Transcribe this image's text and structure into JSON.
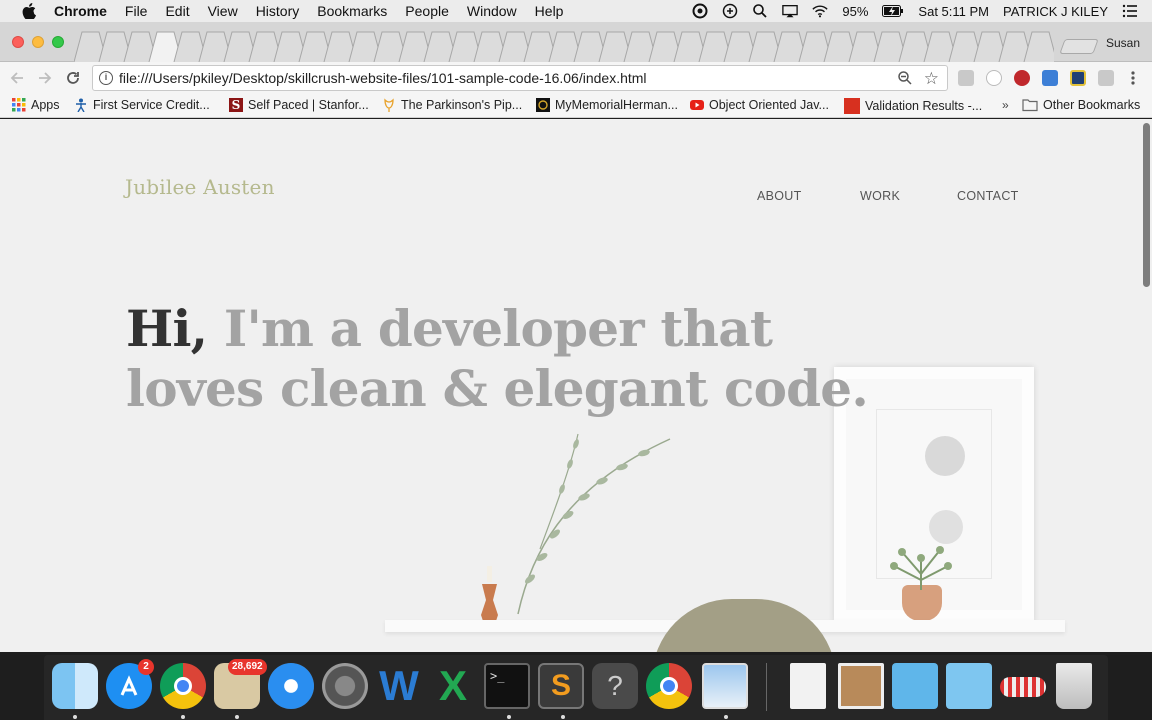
{
  "menubar": {
    "app_name": "Chrome",
    "menus": [
      "File",
      "Edit",
      "View",
      "History",
      "Bookmarks",
      "People",
      "Window",
      "Help"
    ],
    "battery": "95%",
    "clock": "Sat 5:11 PM",
    "user": "PATRICK J KILEY"
  },
  "browser": {
    "profile_name": "Susan",
    "url": "file:///Users/pkiley/Desktop/skillcrush-website-files/101-sample-code-16.06/index.html",
    "bookmarks": [
      {
        "label": "Apps",
        "icon": "apps-grid-icon"
      },
      {
        "label": "First Service Credit...",
        "icon": "figure-icon"
      },
      {
        "label": "Self Paced | Stanfor...",
        "icon": "stanford-s-icon"
      },
      {
        "label": "The Parkinson's Pip...",
        "icon": "tulip-icon"
      },
      {
        "label": "MyMemorialHerman...",
        "icon": "memorial-icon"
      },
      {
        "label": "Object Oriented Jav...",
        "icon": "youtube-icon"
      },
      {
        "label": "Validation Results -...",
        "icon": "w3c-icon"
      },
      {
        "label": "Other Bookmarks",
        "icon": "folder-icon"
      }
    ]
  },
  "page": {
    "logo": "Jubilee Austen",
    "nav": [
      "ABOUT",
      "WORK",
      "CONTACT"
    ],
    "hero_hi": "Hi,",
    "hero_rest": " I'm a developer that loves clean & elegant code."
  },
  "dock": {
    "appstore_badge": "2",
    "mail_badge": "28,692"
  },
  "colors": {
    "logo": "#b5b98e",
    "hero_dark": "#333333",
    "hero_light": "#a3a3a3",
    "page_bg": "#f0f0f0"
  }
}
